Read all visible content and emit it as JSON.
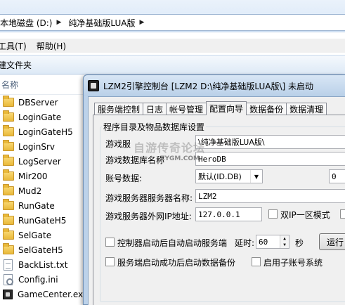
{
  "address_bar": {
    "segments": [
      "本地磁盘 (D:)",
      "纯净基础版LUA版"
    ]
  },
  "menu": {
    "items": [
      "工具(T)",
      "帮助(H)"
    ]
  },
  "toolbar": {
    "new_folder_label": "建文件夹"
  },
  "file_list": {
    "column_header": "名称",
    "items": [
      {
        "name": "DBServer",
        "icon": "folder-icon"
      },
      {
        "name": "LoginGate",
        "icon": "folder-icon"
      },
      {
        "name": "LoginGateH5",
        "icon": "folder-icon"
      },
      {
        "name": "LoginSrv",
        "icon": "folder-icon"
      },
      {
        "name": "LogServer",
        "icon": "folder-icon"
      },
      {
        "name": "Mir200",
        "icon": "folder-icon"
      },
      {
        "name": "Mud2",
        "icon": "folder-icon"
      },
      {
        "name": "RunGate",
        "icon": "folder-icon"
      },
      {
        "name": "RunGateH5",
        "icon": "folder-icon"
      },
      {
        "name": "SelGate",
        "icon": "folder-icon"
      },
      {
        "name": "SelGateH5",
        "icon": "folder-icon"
      },
      {
        "name": "BackList.txt",
        "icon": "text-file-icon"
      },
      {
        "name": "Config.ini",
        "icon": "ini-file-icon"
      },
      {
        "name": "GameCenter.exe",
        "icon": "exe-file-icon"
      }
    ]
  },
  "dialog": {
    "title": "LZM2引擎控制台 [LZM2 D:\\纯净基础版LUA版\\] 未启动",
    "tabs": [
      "服务端控制",
      "日志",
      "帐号管理",
      "配置向导",
      "数据备份",
      "数据清理"
    ],
    "active_tab": "配置向导",
    "group_title": "程序目录及物品数据库设置",
    "fields": {
      "game_dir_label": "游戏服",
      "game_dir_value": "\\纯净基础版LUA版\\",
      "db_name_label": "游戏数据库名称",
      "db_name_value": "HeroDB",
      "account_db_label": "账号数据:",
      "account_db_value": "默认(ID.DB)",
      "account_db_extra": "0",
      "server_name_label": "游戏服务器服务器名称:",
      "server_name_value": "LZM2",
      "server_ip_label": "游戏服务器外网IP地址:",
      "server_ip_value": "127.0.0.1",
      "dual_ip_label": "双IP一区模式",
      "auto_start_label": "控制器启动后自动启动服务端",
      "delay_label": "延时:",
      "delay_value": "60",
      "seconds_label": "秒",
      "run_button": "运行",
      "auto_backup_label": "服务端启动成功后启动数据备份",
      "sub_account_label": "启用子账号系统"
    }
  },
  "watermark": {
    "line1": "自游传奇论坛",
    "line2": "ZYGM.COM"
  }
}
